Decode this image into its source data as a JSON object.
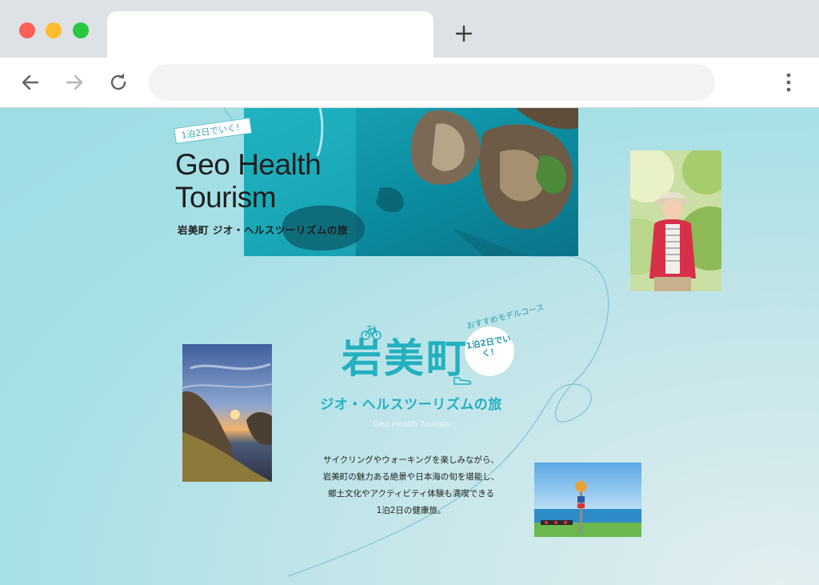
{
  "browser": {
    "tab_title": "",
    "address": "",
    "icons": {
      "back": "arrow-left-icon",
      "forward": "arrow-right-icon",
      "reload": "reload-icon",
      "new_tab": "plus-icon",
      "menu": "kebab-menu-icon"
    }
  },
  "hero": {
    "badge": "1泊2日でいく！",
    "title_line1": "Geo Health",
    "title_line2": "Tourism",
    "subtitle": "岩美町 ジオ・ヘルスツーリズムの旅"
  },
  "feature": {
    "recommend_label": "おすすめモデルコース",
    "circle_badge": "1泊2日でいく！",
    "title": "岩美町",
    "subtitle": "ジオ・ヘルスツーリズムの旅",
    "english": "Geo Health Tourism",
    "description": [
      "サイクリングやウォーキングを楽しみながら、",
      "岩美町の魅力ある絶景や日本海の旬を堪能し、",
      "郷土文化やアクティビティ体験も満喫できる",
      "1泊2日の健康旅。"
    ]
  },
  "colors": {
    "accent": "#23b0bf",
    "page_bg": "#a7e0e6",
    "chrome_bg": "#dee1e6"
  }
}
